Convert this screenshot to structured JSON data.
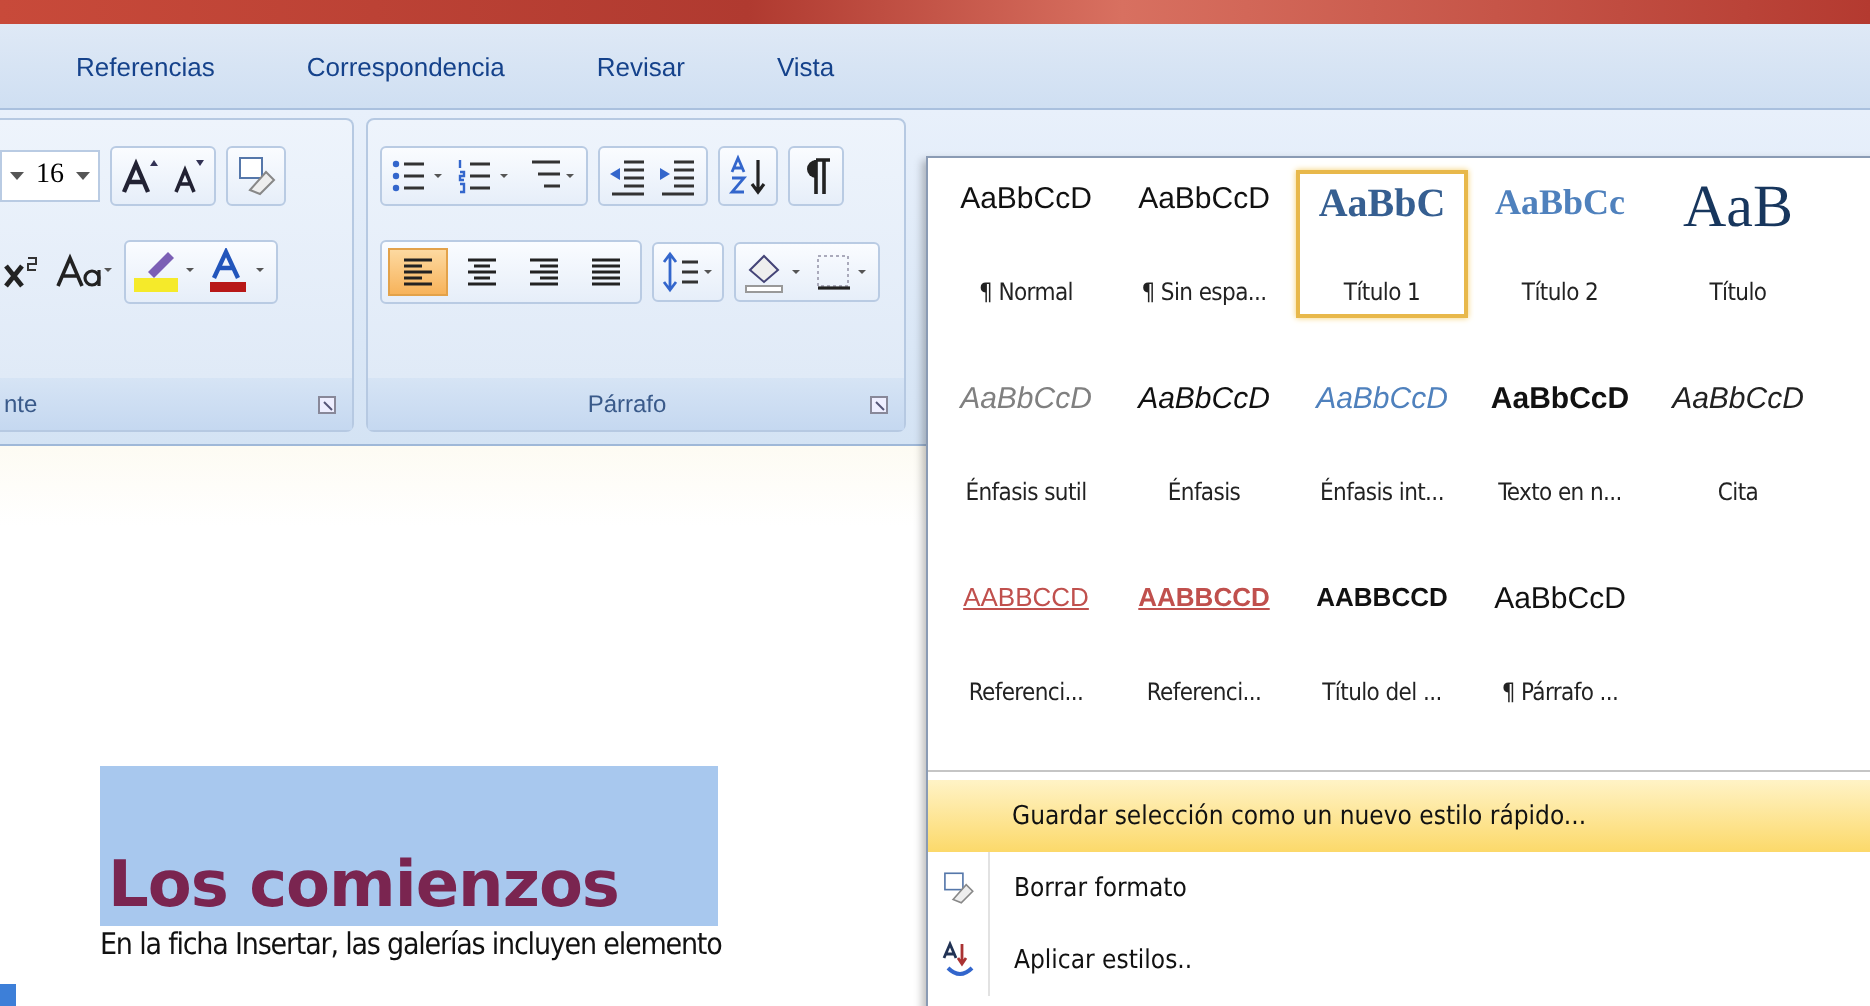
{
  "tabs": [
    {
      "label": "Referencias",
      "selected": false
    },
    {
      "label": "Correspondencia",
      "selected": false
    },
    {
      "label": "Revisar",
      "selected": false
    },
    {
      "label": "Vista",
      "selected": false
    }
  ],
  "font_group": {
    "size": "16",
    "label": "nte"
  },
  "paragraph_group": {
    "label": "Párrafo",
    "align_buttons": [
      {
        "kind": "left",
        "on": true
      },
      {
        "kind": "center",
        "on": false
      },
      {
        "kind": "right",
        "on": false
      },
      {
        "kind": "justify",
        "on": false
      }
    ]
  },
  "styles_gallery": {
    "rows": [
      [
        {
          "sample": "AaBbCcD",
          "label": "¶ Normal",
          "kind": "normal",
          "selected": false
        },
        {
          "sample": "AaBbCcD",
          "label": "¶ Sin espa...",
          "kind": "normal",
          "selected": false
        },
        {
          "sample": "AaBbC",
          "label": "Título 1",
          "kind": "heading1",
          "selected": true
        },
        {
          "sample": "AaBbCc",
          "label": "Título 2",
          "kind": "heading2",
          "selected": false
        },
        {
          "sample": "AaB",
          "label": "Título",
          "kind": "title",
          "selected": false
        }
      ],
      [
        {
          "sample": "AaBbCcD",
          "label": "Énfasis sutil",
          "kind": "subtle",
          "selected": false
        },
        {
          "sample": "AaBbCcD",
          "label": "Énfasis",
          "kind": "emphasis",
          "selected": false
        },
        {
          "sample": "AaBbCcD",
          "label": "Énfasis int...",
          "kind": "intense",
          "selected": false
        },
        {
          "sample": "AaBbCcD",
          "label": "Texto en n...",
          "kind": "strong",
          "selected": false
        },
        {
          "sample": "AaBbCcD",
          "label": "Cita",
          "kind": "quote",
          "selected": false
        }
      ],
      [
        {
          "sample": "AABBCCD",
          "label": "Referenci...",
          "kind": "reference",
          "selected": false
        },
        {
          "sample": "AABBCCD",
          "label": "Referenci...",
          "kind": "reference-strong",
          "selected": false
        },
        {
          "sample": "AABBCCD",
          "label": "Título del ...",
          "kind": "book",
          "selected": false
        },
        {
          "sample": "AaBbCcD",
          "label": "¶ Párrafo ...",
          "kind": "normal",
          "selected": false
        }
      ]
    ],
    "menu": [
      {
        "label": "Guardar selección como un nuevo estilo rápido...",
        "kind": "plain",
        "selected": true
      },
      {
        "label": "Borrar formato",
        "kind": "eraser",
        "selected": false
      },
      {
        "label": "Aplicar estilos..",
        "kind": "apply",
        "selected": false
      }
    ]
  },
  "document": {
    "heading": "Los comienzos",
    "heading_selected": true,
    "body": "En la ficha Insertar, las galerías incluyen elemento"
  }
}
